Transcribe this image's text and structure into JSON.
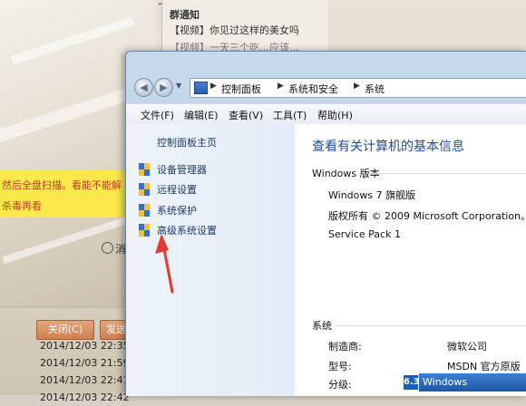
{
  "background_chat": {
    "notice_title": "群通知",
    "notice_line_1": "【视频】你见过这样的美女吗",
    "notice_line_2": "【视频】一天三个吃…应该…",
    "banner_line_1": "然后全盘扫描。看能不能解",
    "banner_line_2": "杀毒再看",
    "history_label": "消",
    "close_button": "关闭(C)",
    "send_button": "发送",
    "log": [
      "2014/12/03 22:35",
      "2014/12/03 21:59",
      "2014/12/03 22:41",
      "2014/12/03 22:42"
    ]
  },
  "explorer": {
    "breadcrumb": [
      "控制面板",
      "系统和安全",
      "系统"
    ],
    "menu": [
      "文件(F)",
      "编辑(E)",
      "查看(V)",
      "工具(T)",
      "帮助(H)"
    ],
    "left_pane": {
      "home": "控制面板主页",
      "tasks": [
        "设备管理器",
        "远程设置",
        "系统保护",
        "高级系统设置"
      ]
    },
    "main": {
      "title": "查看有关计算机的基本信息",
      "edition_header": "Windows 版本",
      "edition": "Windows 7 旗舰版",
      "copyright": "版权所有 © 2009 Microsoft Corporation。",
      "service_pack": "Service Pack 1",
      "system_header": "系统",
      "manufacturer_label": "制造商:",
      "manufacturer_value": "微软公司",
      "model_label": "型号:",
      "model_value": "MSDN 官方原版",
      "rating_label": "分级:",
      "rating_value": "6.3",
      "rating_text": "Windows"
    }
  }
}
